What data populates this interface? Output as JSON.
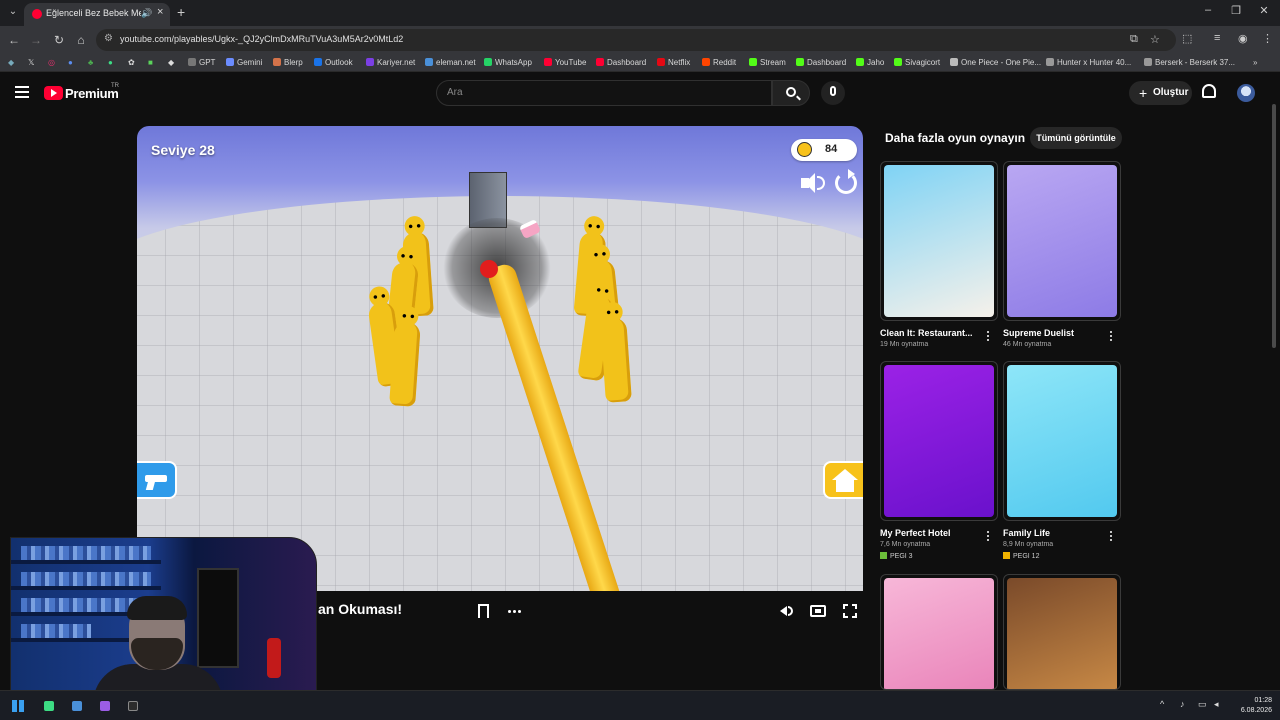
{
  "browser": {
    "tab_title": "Eğlenceli Bez Bebek Meydanı",
    "url": "youtube.com/playables/Ugkx-_QJ2yClmDxMRuTVuA3uM5Ar2v0MtLd2",
    "bookmarks": [
      "GPT",
      "Gemini",
      "Blerp",
      "Outlook",
      "Kariyer.net",
      "eleman.net",
      "WhatsApp",
      "YouTube",
      "Dashboard",
      "Netflix",
      "Reddit",
      "Stream",
      "Dashboard",
      "Jaho",
      "Sivagicort",
      "One Piece - One Pie...",
      "Hunter x Hunter 40...",
      "Berserk - Berserk 37..."
    ]
  },
  "youtube": {
    "logo_text": "Premium",
    "logo_region": "TR",
    "search_placeholder": "Ara",
    "create_label": "Oluştur"
  },
  "game": {
    "level_label": "Seviye 28",
    "kill_count": "84"
  },
  "player": {
    "title_partial": "an Okuması!"
  },
  "sidebar": {
    "title": "Daha fazla oyun oynayın",
    "see_all_label": "Tümünü görüntüle",
    "games": [
      {
        "title": "Clean It: Restaurant...",
        "plays": "19 Mn oynatma",
        "pegi": "",
        "colors": [
          "#7fd3f5",
          "#f6f1ea"
        ]
      },
      {
        "title": "Supreme Duelist",
        "plays": "46 Mn oynatma",
        "pegi": "",
        "colors": [
          "#b9a7f2",
          "#8d7be6"
        ]
      },
      {
        "title": "My Perfect Hotel",
        "plays": "7,6 Mn oynatma",
        "pegi": "PEGI 3",
        "colors": [
          "#9b22e6",
          "#6a11cc"
        ]
      },
      {
        "title": "Family Life",
        "plays": "8,9 Mn oynatma",
        "pegi": "PEGI 12",
        "colors": [
          "#8ee6f8",
          "#52c9ef"
        ]
      },
      {
        "title": "",
        "plays": "",
        "pegi": "",
        "colors": [
          "#f7b7d8",
          "#e983b9"
        ]
      },
      {
        "title": "",
        "plays": "",
        "pegi": "",
        "colors": [
          "#7a4a2a",
          "#c98a46"
        ]
      }
    ]
  },
  "taskbar": {
    "time": "01:28",
    "date": "6.08.2026"
  }
}
